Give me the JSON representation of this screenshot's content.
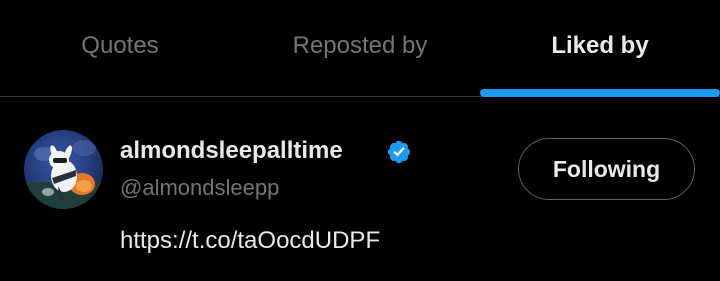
{
  "tabs": [
    {
      "label": "Quotes",
      "selected": false
    },
    {
      "label": "Reposted by",
      "selected": false
    },
    {
      "label": "Liked by",
      "selected": true
    }
  ],
  "colors": {
    "background": "#000000",
    "text_primary": "#e7e9ea",
    "text_secondary": "#71767b",
    "accent": "#1d9bf0",
    "divider": "#2f3336"
  },
  "user": {
    "display_name": "almondsleepalltime",
    "handle": "@almondsleepp",
    "verified": true,
    "bio": "https://t.co/taOocdUDPF",
    "follow_button_label": "Following",
    "avatar_icon": "cartoon-avatar"
  }
}
